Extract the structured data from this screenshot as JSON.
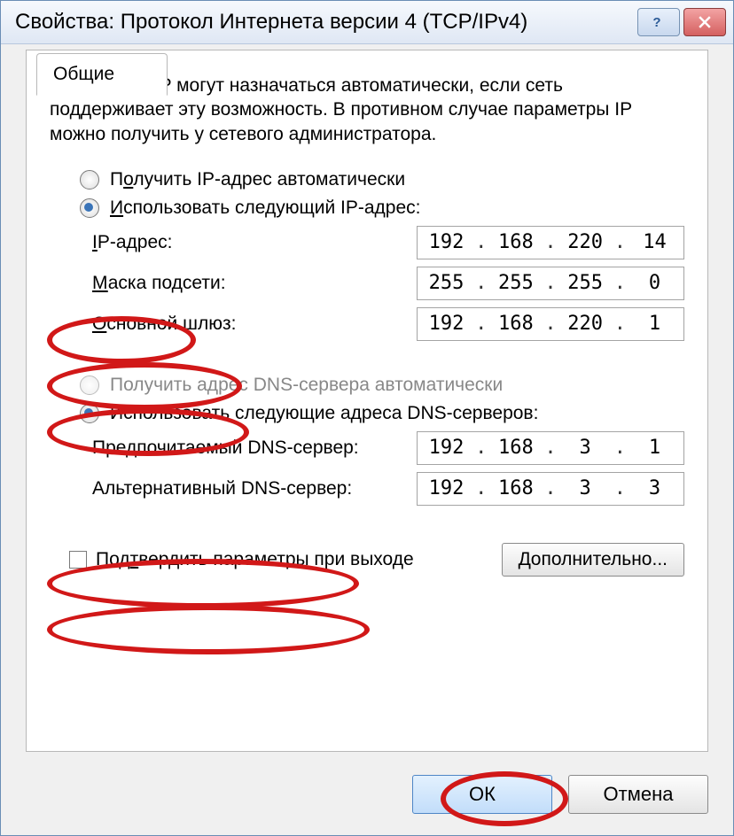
{
  "window": {
    "title": "Свойства: Протокол Интернета версии 4 (TCP/IPv4)"
  },
  "tab": {
    "label": "Общие"
  },
  "description": "Параметры IP могут назначаться автоматически, если сеть поддерживает эту возможность. В противном случае параметры IP можно получить у сетевого администратора.",
  "ip_section": {
    "auto_label_pre": "П",
    "auto_label_u": "о",
    "auto_label_post": "лучить IP-адрес автоматически",
    "manual_label_pre": "",
    "manual_label_u": "И",
    "manual_label_post": "спользовать следующий IP-адрес:",
    "ip_label_pre": "",
    "ip_label_u": "I",
    "ip_label_post": "P-адрес:",
    "mask_label_pre": "",
    "mask_label_u": "М",
    "mask_label_post": "аска подсети:",
    "gw_label_pre": "",
    "gw_label_u": "О",
    "gw_label_post": "сновной шлюз:",
    "ip": [
      "192",
      "168",
      "220",
      "14"
    ],
    "mask": [
      "255",
      "255",
      "255",
      "0"
    ],
    "gw": [
      "192",
      "168",
      "220",
      "1"
    ]
  },
  "dns_section": {
    "auto_label": "Получить адрес DNS-сервера автоматически",
    "manual_label": "Использовать следующие адреса DNS-серверов:",
    "pref_label": "Предпочитаемый DNS-сервер:",
    "alt_label": "Альтернативный DNS-сервер:",
    "pref": [
      "192",
      "168",
      "3",
      "1"
    ],
    "alt": [
      "192",
      "168",
      "3",
      "3"
    ]
  },
  "confirm_label_pre": "Под",
  "confirm_label_u": "т",
  "confirm_label_post": "вердить параметры при выходе",
  "advanced_label_pre": "",
  "advanced_label_u": "Д",
  "advanced_label_post": "ополнительно...",
  "ok_label": "ОК",
  "cancel_label": "Отмена"
}
